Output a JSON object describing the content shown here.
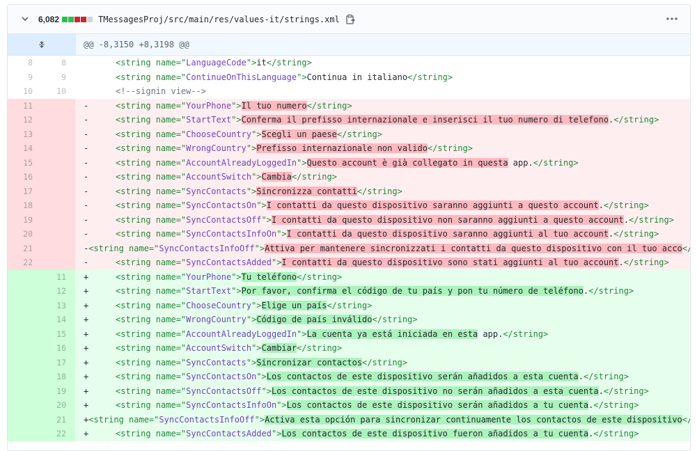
{
  "file": {
    "changes_count": "6,082",
    "path": "TMessagesProj/src/main/res/values-it/strings.xml",
    "diffstat_colors": [
      "#2cbe4e",
      "#2cbe4e",
      "#cb2431",
      "#cb2431",
      "#d1d5da"
    ],
    "hunk_header": "@@ -8,3150 +8,3198 @@"
  },
  "tokens": {
    "open": "<string name=\"",
    "mid": "\">",
    "close": "</string>",
    "minus": "-",
    "plus": "+"
  },
  "context_rows": [
    {
      "old": "8",
      "new": "8",
      "name": "LanguageCode",
      "text": "it"
    },
    {
      "old": "9",
      "new": "9",
      "name": "ContinueOnThisLanguage",
      "text": "Continua in italiano"
    },
    {
      "old": "10",
      "new": "10",
      "comment": "<!--signin view-->"
    }
  ],
  "deleted_rows": [
    {
      "num": "11",
      "name": "YourPhone",
      "text": "Il tuo numero"
    },
    {
      "num": "12",
      "name": "StartText",
      "text": "Conferma il prefisso internazionale e inserisci il tuo numero di telefono",
      "tail": "."
    },
    {
      "num": "13",
      "name": "ChooseCountry",
      "text": "Scegli un paese"
    },
    {
      "num": "14",
      "name": "WrongCountry",
      "text": "Prefisso internazionale non valido"
    },
    {
      "num": "15",
      "name": "AccountAlreadyLoggedIn",
      "text": "Questo account è già collegato in questa",
      "tail": " app."
    },
    {
      "num": "16",
      "name": "AccountSwitch",
      "text": "Cambia"
    },
    {
      "num": "17",
      "name": "SyncContacts",
      "text": "Sincronizza contatti"
    },
    {
      "num": "18",
      "name": "SyncContactsOn",
      "text": "I contatti da questo dispositivo saranno aggiunti a questo account",
      "tail": "."
    },
    {
      "num": "19",
      "name": "SyncContactsOff",
      "text": "I contatti da questo dispositivo non saranno aggiunti a questo account",
      "tail": "."
    },
    {
      "num": "20",
      "name": "SyncContactsInfoOn",
      "text": "I contatti da questo dispositivo saranno aggiunti al tuo account",
      "tail": "."
    },
    {
      "num": "21",
      "name": "SyncContactsInfoOff",
      "text": "Attiva per mantenere sincronizzati i contatti da questo dispositivo con il tuo acco",
      "tail": ""
    },
    {
      "num": "22",
      "name": "SyncContactsAdded",
      "text": "I contatti da questo dispositivo sono stati aggiunti al tuo account",
      "tail": "."
    }
  ],
  "added_rows": [
    {
      "num": "11",
      "name": "YourPhone",
      "text": "Tu teléfono"
    },
    {
      "num": "12",
      "name": "StartText",
      "text": "Por favor, confirma el código de tu país y pon tu número de teléfono",
      "tail": "."
    },
    {
      "num": "13",
      "name": "ChooseCountry",
      "text": "Elige un país"
    },
    {
      "num": "14",
      "name": "WrongCountry",
      "text": "Código de país inválido"
    },
    {
      "num": "15",
      "name": "AccountAlreadyLoggedIn",
      "text": "La cuenta ya está iniciada en esta",
      "tail": " app."
    },
    {
      "num": "16",
      "name": "AccountSwitch",
      "text": "Cambiar"
    },
    {
      "num": "17",
      "name": "SyncContacts",
      "text": "Sincronizar contactos"
    },
    {
      "num": "18",
      "name": "SyncContactsOn",
      "text": "Los contactos de este dispositivo serán añadidos a esta cuenta",
      "tail": "."
    },
    {
      "num": "19",
      "name": "SyncContactsOff",
      "text": "Los contactos de este dispositivo no serán añadidos a esta cuenta",
      "tail": "."
    },
    {
      "num": "20",
      "name": "SyncContactsInfoOn",
      "text": "Los contactos de este dispositivo serán añadidos a tu cuenta",
      "tail": "."
    },
    {
      "num": "21",
      "name": "SyncContactsInfoOff",
      "text": "Activa esta opción para sincronizar continuamente los contactos de este dispositivo",
      "tail": ""
    },
    {
      "num": "22",
      "name": "SyncContactsAdded",
      "text": "Los contactos de este dispositivo fueron añadidos a tu cuenta",
      "tail": "."
    }
  ],
  "colors": {
    "deleted_bg": "#ffeef0",
    "added_bg": "#e6ffed",
    "hunk_bg": "#f1f8ff"
  }
}
